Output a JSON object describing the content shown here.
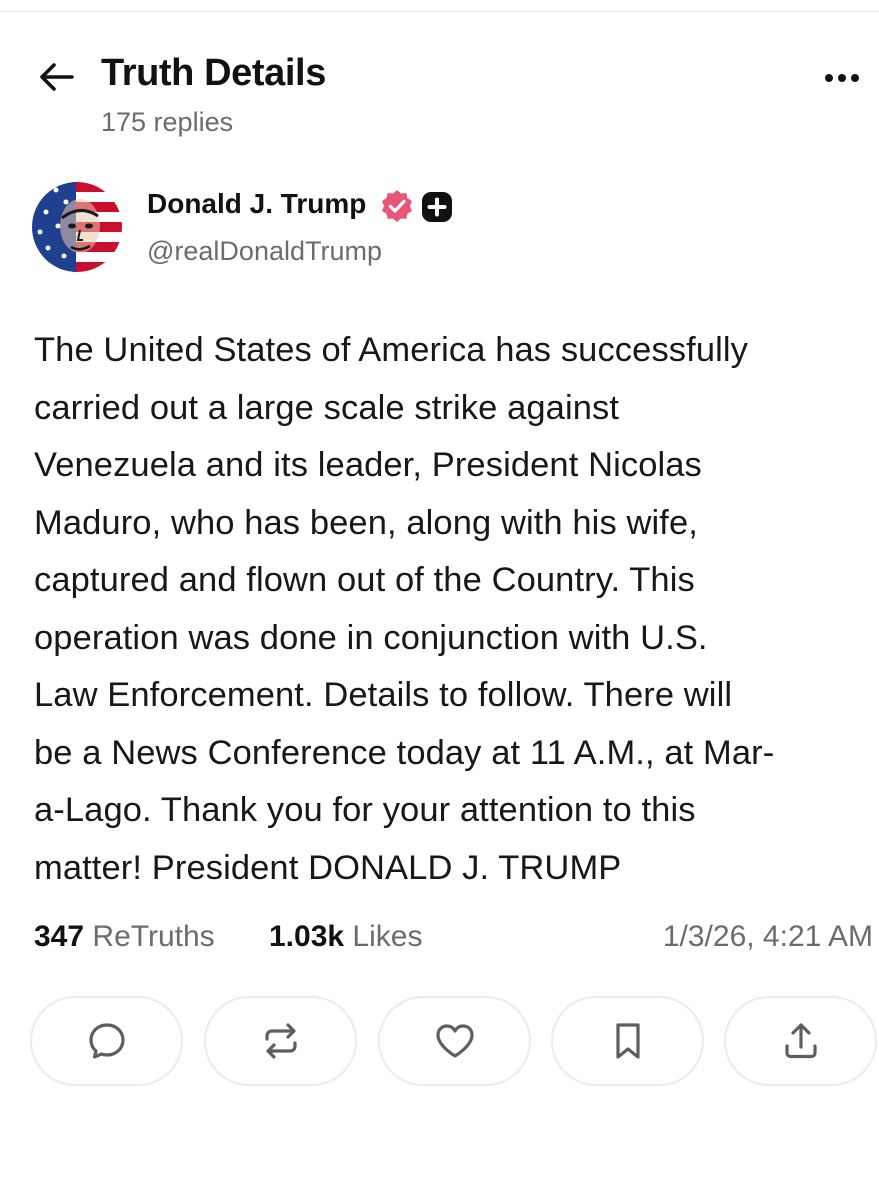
{
  "header": {
    "title": "Truth Details",
    "replies": "175 replies"
  },
  "author": {
    "name": "Donald J. Trump",
    "handle": "@realDonaldTrump"
  },
  "post": {
    "lines": [
      "The United States of America has successfully",
      "carried out a large scale strike against",
      "Venezuela and its leader, President Nicolas",
      "Maduro, who has been, along with his wife,",
      "captured and flown out of the Country. This",
      "operation was done in conjunction with U.S.",
      "Law Enforcement. Details to follow. There will",
      "be a News Conference today at 11 A.M., at Mar-",
      "a-Lago. Thank you for your attention to this",
      "matter! President DONALD J. TRUMP"
    ]
  },
  "stats": {
    "retruths_count": "347",
    "retruths_label": "ReTruths",
    "likes_count": "1.03k",
    "likes_label": "Likes",
    "timestamp": "1/3/26, 4:21 AM"
  },
  "icons": {
    "back": "arrow-left-icon",
    "more": "more-horizontal-icon",
    "verified": "verified-badge-icon",
    "plus": "plus-badge-icon",
    "reply": "comment-icon",
    "retruth": "repeat-icon",
    "like": "heart-icon",
    "bookmark": "bookmark-icon",
    "share": "share-icon"
  },
  "colors": {
    "verified": "#e8577a",
    "muted_text": "#6b6b72",
    "border": "#ececef"
  }
}
